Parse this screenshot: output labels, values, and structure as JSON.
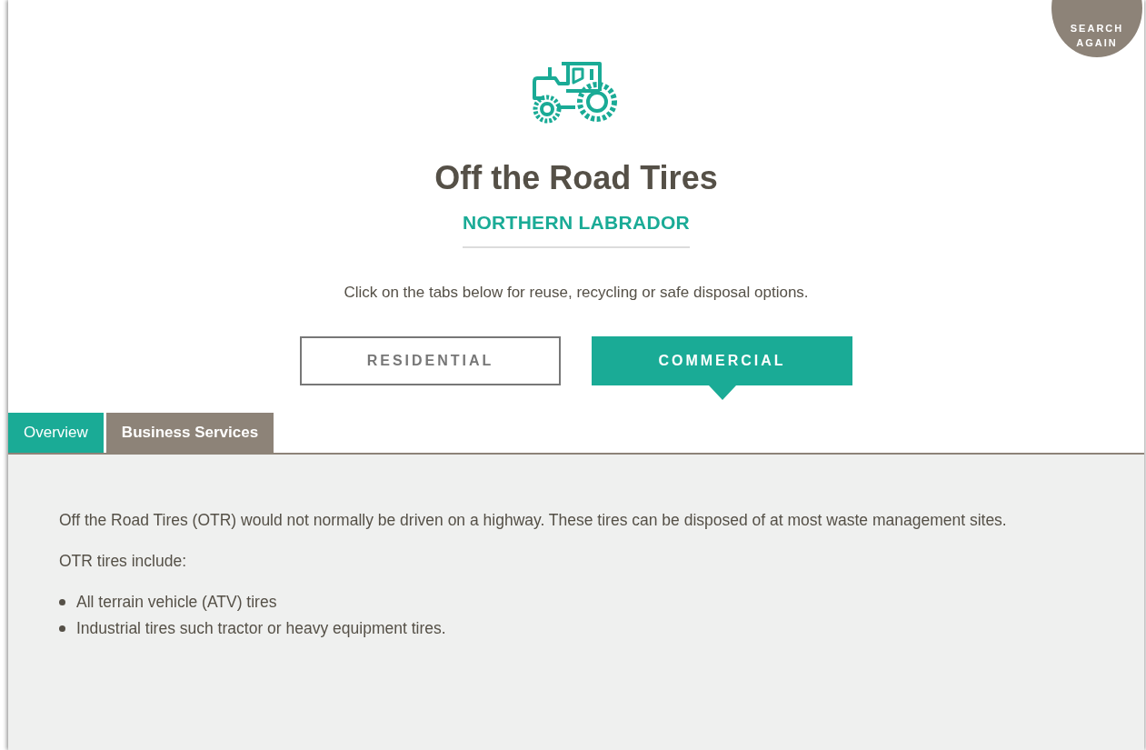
{
  "search_again": {
    "label": "SEARCH AGAIN"
  },
  "title": "Off the Road Tires",
  "region": "NORTHERN LABRADOR",
  "instructions": "Click on the tabs below for reuse, recycling or safe disposal options.",
  "audience_tabs": [
    {
      "label": "RESIDENTIAL",
      "selected": false
    },
    {
      "label": "COMMERCIAL",
      "selected": true
    }
  ],
  "section_tabs": [
    {
      "label": "Overview",
      "selected": true
    },
    {
      "label": "Business Services",
      "selected": false
    }
  ],
  "content": {
    "paragraphs": [
      "Off the Road Tires (OTR) would not normally be driven on a highway. These tires can be disposed of at most waste management sites.",
      "OTR tires include:"
    ],
    "bullets": [
      "All terrain vehicle (ATV) tires",
      "Industrial tires such tractor or heavy equipment tires."
    ]
  }
}
